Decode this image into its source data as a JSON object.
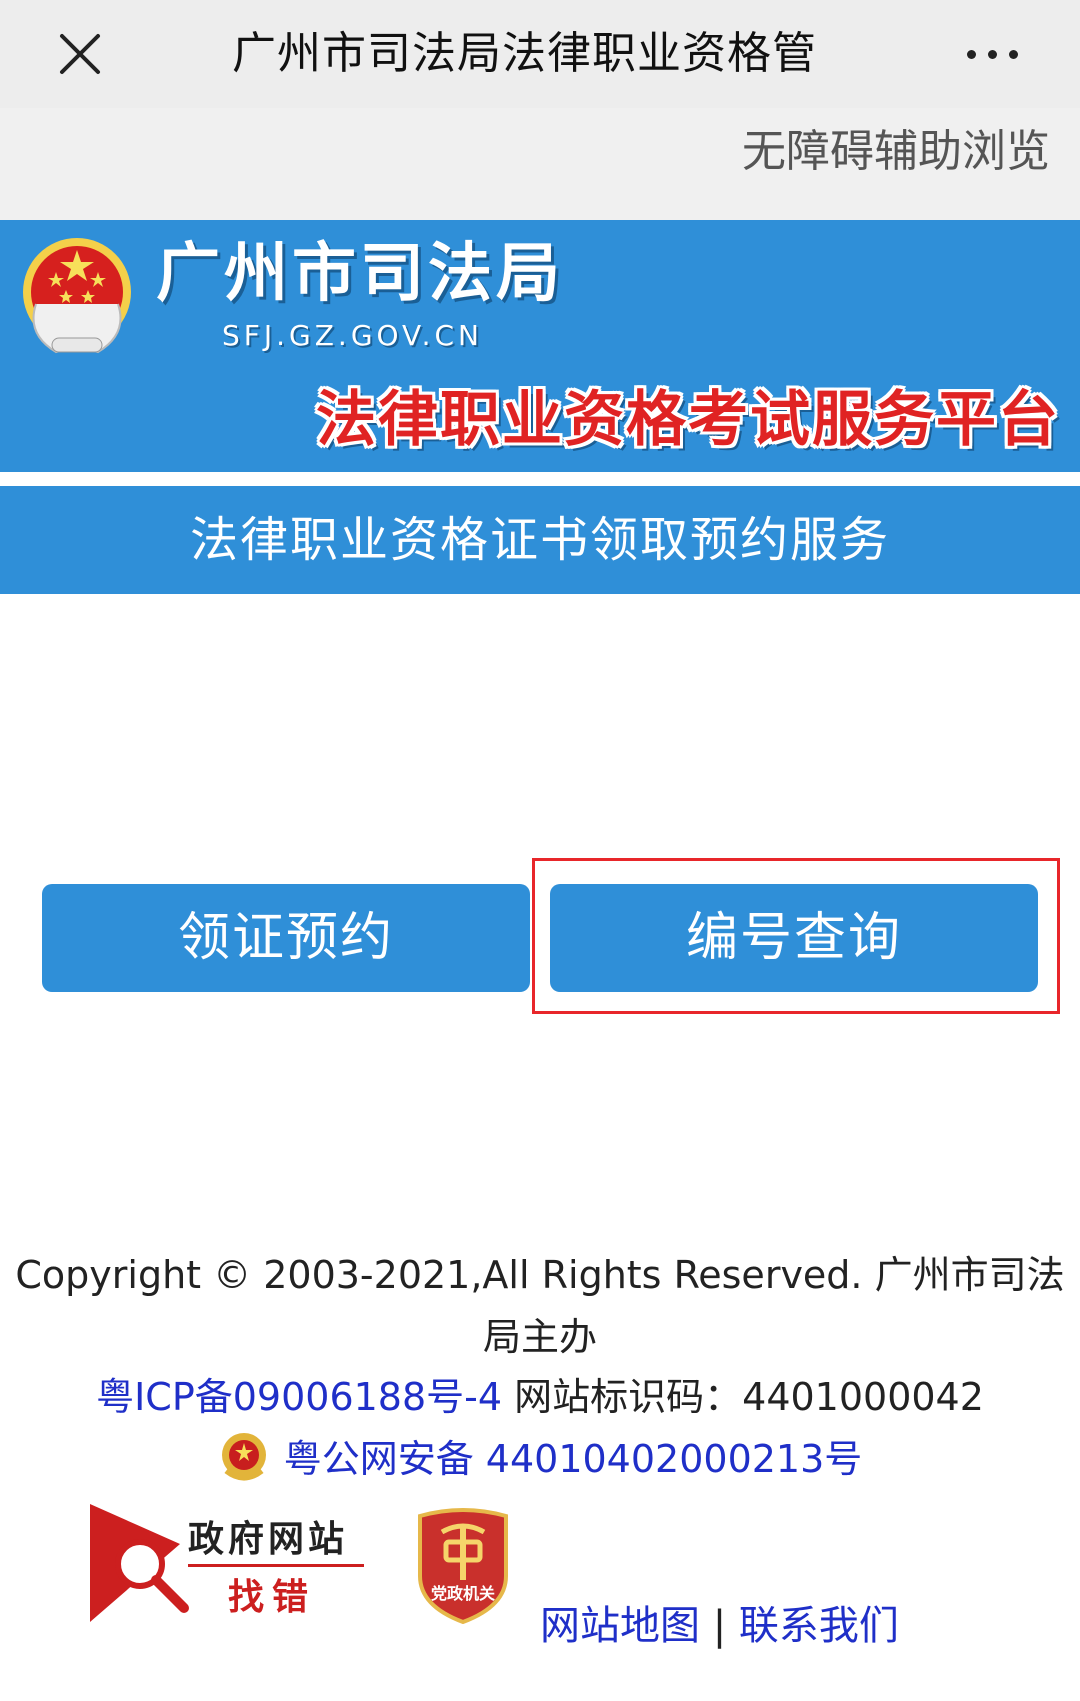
{
  "topbar": {
    "title": "广州市司法局法律职业资格管",
    "close_icon": "close-icon",
    "more_icon": "more-dots-icon"
  },
  "a11y": {
    "label": "无障碍辅助浏览"
  },
  "banner": {
    "site_name": "广州市司法局",
    "site_domain": "SFJ.GZ.GOV.CN",
    "platform_name": "法律职业资格考试服务平台",
    "emblem_icon": "justice-emblem-icon"
  },
  "service": {
    "title": "法律职业资格证书领取预约服务"
  },
  "actions": {
    "book_label": "领证预约",
    "query_label": "编号查询"
  },
  "footer": {
    "copyright": "Copyright © 2003-2021,All Rights Reserved. 广州市司法局主办",
    "icp_label": "粤ICP备09006188号-4",
    "site_code_label": "网站标识码：4401000042",
    "police_label": "粤公网安备 44010402000213号",
    "gov_find_error_title": "政府网站",
    "gov_find_error_sub": "找错",
    "party_badge_label": "党政机关",
    "sitemap_label": "网站地图",
    "separator": "|",
    "contact_label": "联系我们"
  },
  "colors": {
    "brand_blue": "#2f8fd8",
    "highlight_red": "#e8262a",
    "link_blue": "#1f2fc8",
    "platform_red": "#e02323"
  }
}
